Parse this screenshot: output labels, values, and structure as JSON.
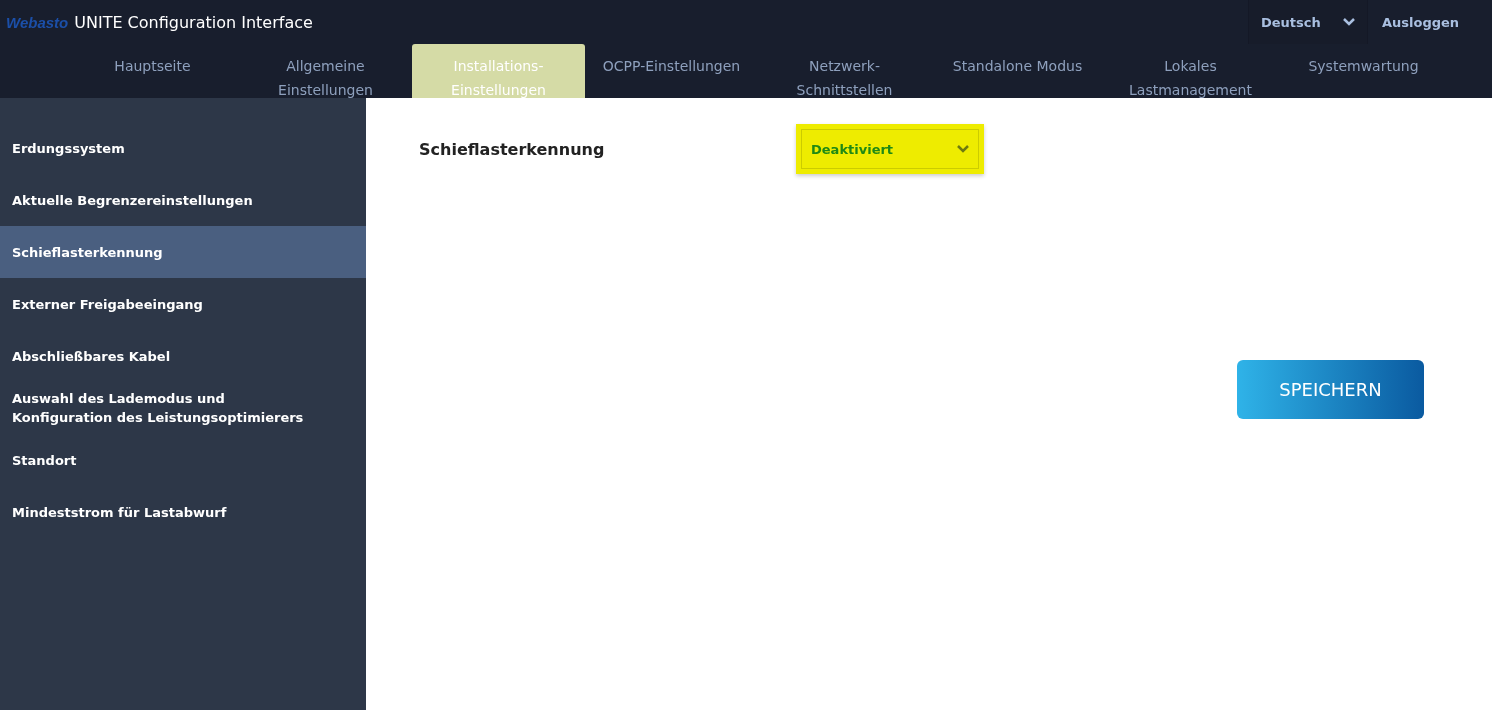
{
  "header": {
    "logo": "Webasto",
    "title": "UNITE Configuration Interface",
    "language": "Deutsch",
    "logout": "Ausloggen"
  },
  "tabs": [
    {
      "lines": [
        "Hauptseite"
      ],
      "selected": false
    },
    {
      "lines": [
        "Allgemeine",
        "Einstellungen"
      ],
      "selected": false
    },
    {
      "lines": [
        "Installations-",
        "Einstellungen"
      ],
      "selected": true
    },
    {
      "lines": [
        "OCPP-Einstellungen"
      ],
      "selected": false
    },
    {
      "lines": [
        "Netzwerk-",
        "Schnittstellen"
      ],
      "selected": false
    },
    {
      "lines": [
        "Standalone Modus"
      ],
      "selected": false
    },
    {
      "lines": [
        "Lokales",
        "Lastmanagement"
      ],
      "selected": false
    },
    {
      "lines": [
        "Systemwartung"
      ],
      "selected": false
    }
  ],
  "sidebar": {
    "items": [
      {
        "label": "Erdungssystem",
        "selected": false
      },
      {
        "label": "Aktuelle Begrenzereinstellungen",
        "selected": false
      },
      {
        "label": "Schieflasterkennung",
        "selected": true
      },
      {
        "label": "Externer Freigabeeingang",
        "selected": false
      },
      {
        "label": "Abschließbares Kabel",
        "selected": false
      },
      {
        "label": "Auswahl des Lademodus und Konfiguration des Leistungsoptimierers",
        "selected": false
      },
      {
        "label": "Standort",
        "selected": false
      },
      {
        "label": "Mindeststrom für Lastabwurf",
        "selected": false
      }
    ]
  },
  "setting": {
    "label": "Schieflasterkennung",
    "value": "Deaktiviert"
  },
  "save_button": "SPEICHERN"
}
